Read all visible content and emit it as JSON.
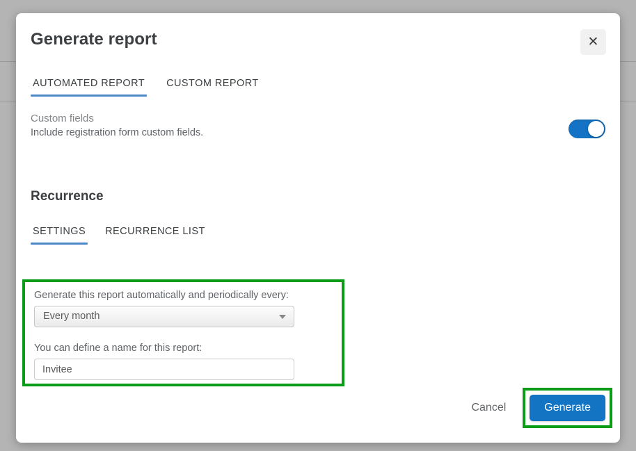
{
  "modal": {
    "title": "Generate report",
    "close_icon": "close-icon",
    "close_label": "✕"
  },
  "tabs": [
    {
      "label": "AUTOMATED REPORT",
      "active": true
    },
    {
      "label": "CUSTOM REPORT",
      "active": false
    }
  ],
  "custom_fields": {
    "title": "Custom fields",
    "description": "Include registration form custom fields.",
    "toggle_on": true
  },
  "recurrence": {
    "heading": "Recurrence",
    "tabs": [
      {
        "label": "SETTINGS",
        "active": true
      },
      {
        "label": "RECURRENCE LIST",
        "active": false
      }
    ],
    "settings": {
      "frequency_label": "Generate this report automatically and periodically every:",
      "frequency_value": "Every month",
      "frequency_arrow_icon": "chevron-down-icon",
      "name_label": "You can define a name for this report:",
      "name_value": "Invitee",
      "name_placeholder": "Invitee"
    }
  },
  "footer": {
    "cancel_label": "Cancel",
    "generate_label": "Generate"
  },
  "colors": {
    "accent_blue": "#1474c4",
    "tab_underline": "#4a86c8",
    "highlight_green": "#0c9c18",
    "backdrop": "#b4b4b4"
  }
}
